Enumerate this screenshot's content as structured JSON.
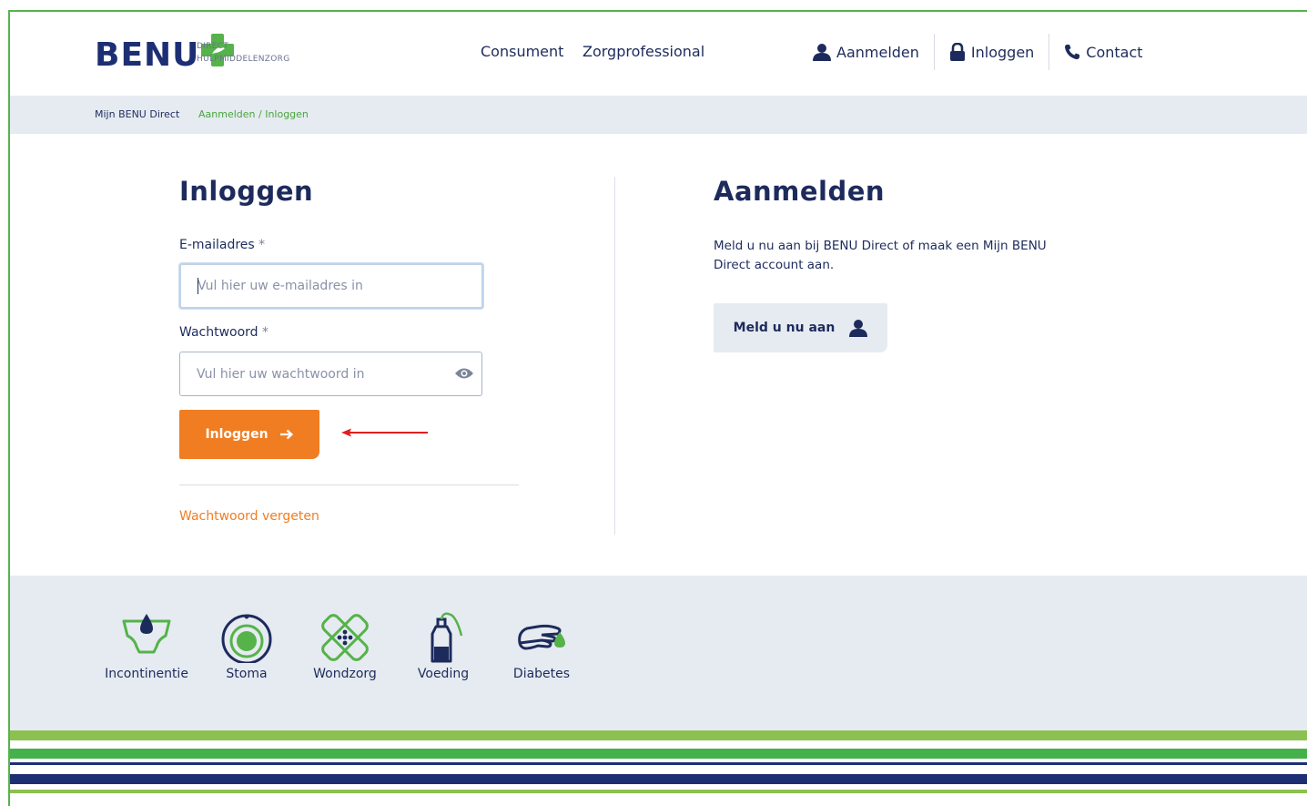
{
  "brand": {
    "name": "BENU",
    "sub_line1": "DIRECT",
    "sub_line2": "HULPMIDDELENZORG",
    "green": "#55b34a",
    "navy": "#1d2f73",
    "orange": "#f07d22"
  },
  "nav": {
    "consument": "Consument",
    "zorgprofessional": "Zorgprofessional"
  },
  "user_nav": {
    "aanmelden": "Aanmelden",
    "inloggen": "Inloggen",
    "contact": "Contact"
  },
  "breadcrumb": {
    "home": "Mijn BENU Direct",
    "current": "Aanmelden / Inloggen"
  },
  "login": {
    "title": "Inloggen",
    "email_label": "E-mailadres",
    "email_placeholder": "Vul hier uw e-mailadres in",
    "password_label": "Wachtwoord",
    "password_placeholder": "Vul hier uw wachtwoord in",
    "required_mark": "*",
    "submit_label": "Inloggen",
    "forgot_link": "Wachtwoord vergeten"
  },
  "register": {
    "title": "Aanmelden",
    "text": "Meld u nu aan bij BENU Direct of maak een Mijn BENU Direct account aan.",
    "button_label": "Meld u nu aan"
  },
  "categories": [
    {
      "label": "Incontinentie",
      "icon": "incontinence-icon"
    },
    {
      "label": "Stoma",
      "icon": "stoma-icon"
    },
    {
      "label": "Wondzorg",
      "icon": "wound-care-icon"
    },
    {
      "label": "Voeding",
      "icon": "nutrition-icon"
    },
    {
      "label": "Diabetes",
      "icon": "diabetes-icon"
    }
  ]
}
